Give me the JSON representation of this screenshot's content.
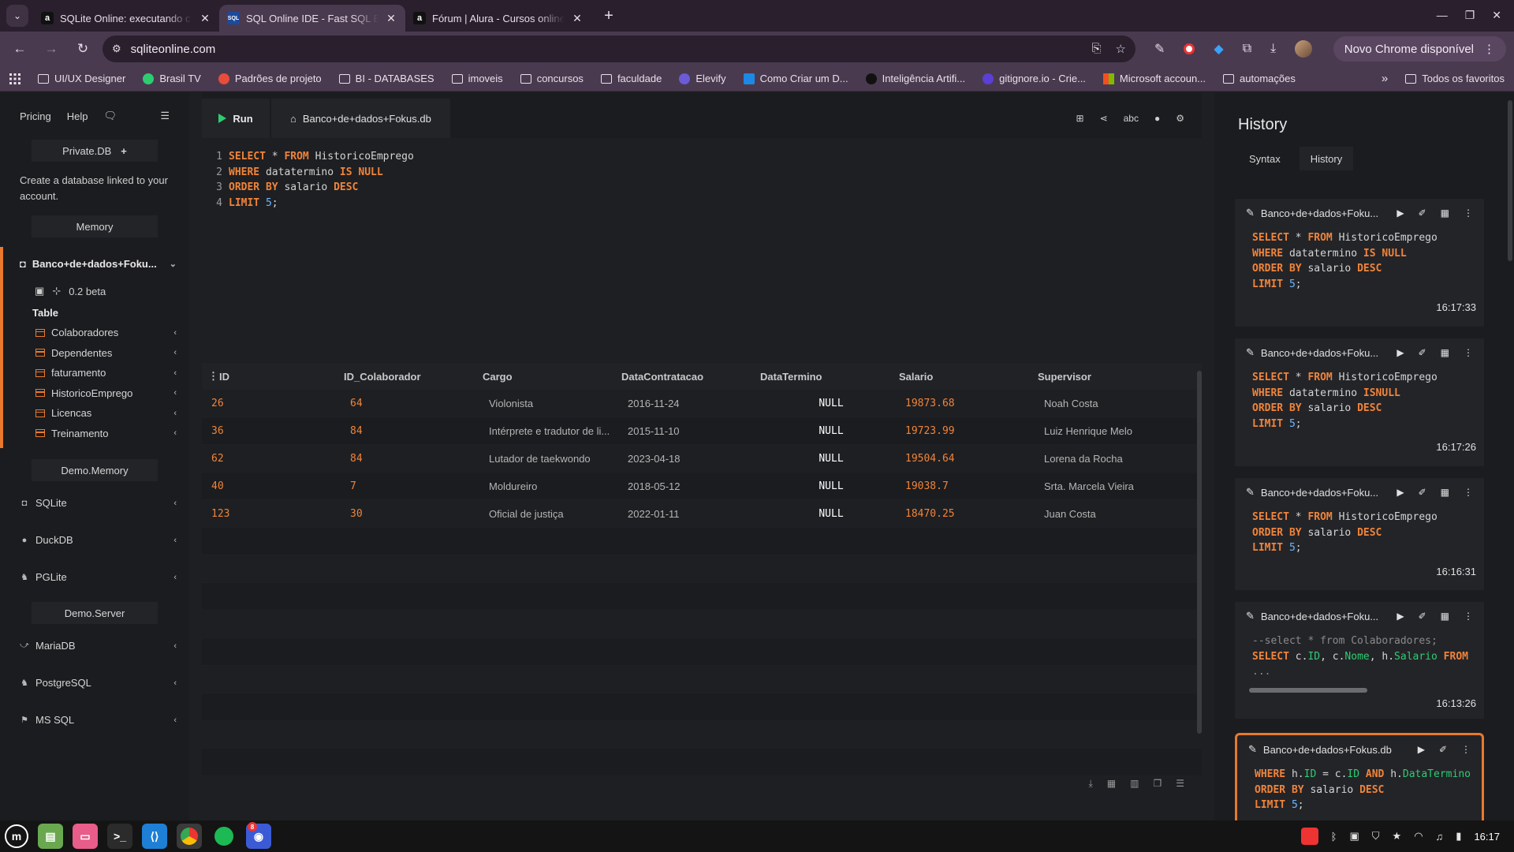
{
  "browser": {
    "tabs": [
      {
        "title": "SQLite Online: executando c",
        "favicon": "alura-icon",
        "active": false
      },
      {
        "title": "SQL Online IDE - Fast SQL Ed",
        "favicon": "sql-icon",
        "active": true
      },
      {
        "title": "Fórum | Alura - Cursos online",
        "favicon": "alura-icon",
        "active": false
      }
    ],
    "url": "sqliteonline.com",
    "update_label": "Novo Chrome disponível",
    "bookmarks": [
      "UI/UX Designer",
      "Brasil TV",
      "Padrões de projeto",
      "BI - DATABASES",
      "imoveis",
      "concursos",
      "faculdade",
      "Elevify",
      "Como Criar um D...",
      "Inteligência Artifi...",
      "gitignore.io - Crie...",
      "Microsoft accoun...",
      "automações"
    ],
    "all_bookmarks": "Todos os favoritos"
  },
  "sidebar": {
    "pricing": "Pricing",
    "help": "Help",
    "private_db": "Private.DB",
    "private_note": "Create a database linked to your account.",
    "memory": "Memory",
    "db_name": "Banco+de+dados+Foku...",
    "db_version": "0.2 beta",
    "table_label": "Table",
    "tables": [
      "Colaboradores",
      "Dependentes",
      "faturamento",
      "HistoricoEmprego",
      "Licencas",
      "Treinamento"
    ],
    "demo_memory": "Demo.Memory",
    "demo_memory_items": [
      "SQLite",
      "DuckDB",
      "PGLite"
    ],
    "demo_server": "Demo.Server",
    "demo_server_items": [
      "MariaDB",
      "PostgreSQL",
      "MS SQL"
    ]
  },
  "editor": {
    "run_label": "Run",
    "file_tab": "Banco+de+dados+Fokus.db",
    "lines": [
      "1",
      "2",
      "3",
      "4"
    ]
  },
  "grid": {
    "columns": [
      "ID",
      "ID_Colaborador",
      "Cargo",
      "DataContratacao",
      "DataTermino",
      "Salario",
      "Supervisor"
    ],
    "rows": [
      [
        "26",
        "64",
        "Violonista",
        "2016-11-24",
        "NULL",
        "19873.68",
        "Noah Costa"
      ],
      [
        "36",
        "84",
        "Intérprete e tradutor de li...",
        "2015-11-10",
        "NULL",
        "19723.99",
        "Luiz Henrique Melo"
      ],
      [
        "62",
        "84",
        "Lutador de taekwondo",
        "2023-04-18",
        "NULL",
        "19504.64",
        "Lorena da Rocha"
      ],
      [
        "40",
        "7",
        "Moldureiro",
        "2018-05-12",
        "NULL",
        "19038.7",
        "Srta. Marcela Vieira"
      ],
      [
        "123",
        "30",
        "Oficial de justiça",
        "2022-01-11",
        "NULL",
        "18470.25",
        "Juan Costa"
      ]
    ]
  },
  "history": {
    "title": "History",
    "tabs": [
      "Syntax",
      "History"
    ],
    "cards": [
      {
        "db": "Banco+de+dados+Foku...",
        "time": "16:17:33"
      },
      {
        "db": "Banco+de+dados+Foku...",
        "time": "16:17:26"
      },
      {
        "db": "Banco+de+dados+Foku...",
        "time": "16:16:31"
      },
      {
        "db": "Banco+de+dados+Foku...",
        "time": "16:13:26"
      },
      {
        "db": "Banco+de+dados+Fokus.db",
        "time": ""
      }
    ]
  },
  "taskbar": {
    "badge": "8",
    "clock": "16:17"
  },
  "colors": {
    "accent": "#e8792d",
    "run_green": "#2ecc71"
  }
}
